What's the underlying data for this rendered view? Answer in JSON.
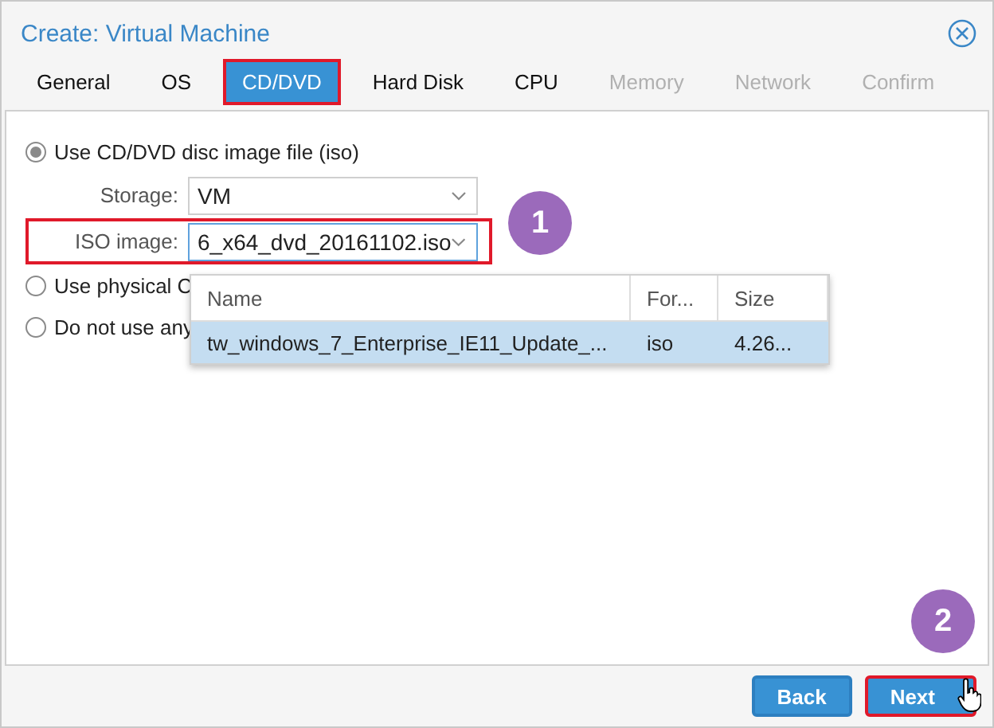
{
  "window": {
    "title": "Create: Virtual Machine"
  },
  "tabs": [
    {
      "label": "General",
      "selected": false,
      "disabled": false,
      "highlighted": false
    },
    {
      "label": "OS",
      "selected": false,
      "disabled": false,
      "highlighted": false
    },
    {
      "label": "CD/DVD",
      "selected": true,
      "disabled": false,
      "highlighted": true
    },
    {
      "label": "Hard Disk",
      "selected": false,
      "disabled": false,
      "highlighted": false
    },
    {
      "label": "CPU",
      "selected": false,
      "disabled": false,
      "highlighted": false
    },
    {
      "label": "Memory",
      "selected": false,
      "disabled": true,
      "highlighted": false
    },
    {
      "label": "Network",
      "selected": false,
      "disabled": true,
      "highlighted": false
    },
    {
      "label": "Confirm",
      "selected": false,
      "disabled": true,
      "highlighted": false
    }
  ],
  "options": [
    {
      "label": "Use CD/DVD disc image file (iso)",
      "selected": true
    },
    {
      "label": "Use physical C",
      "selected": false
    },
    {
      "label": "Do not use any",
      "selected": false
    }
  ],
  "fields": [
    {
      "label": "Storage:",
      "value": "VM",
      "focused": false,
      "highlighted": false
    },
    {
      "label": "ISO image:",
      "value": "6_x64_dvd_20161102.iso",
      "focused": true,
      "highlighted": true
    }
  ],
  "dropdown": {
    "columns": [
      "Name",
      "For...",
      "Size"
    ],
    "rows": [
      {
        "cells": [
          "tw_windows_7_Enterprise_IE11_Update_...",
          "iso",
          "4.26..."
        ],
        "selected": true
      }
    ]
  },
  "callouts": [
    "1",
    "2"
  ],
  "buttons": [
    {
      "label": "Back",
      "highlighted": false
    },
    {
      "label": "Next",
      "highlighted": true
    }
  ]
}
